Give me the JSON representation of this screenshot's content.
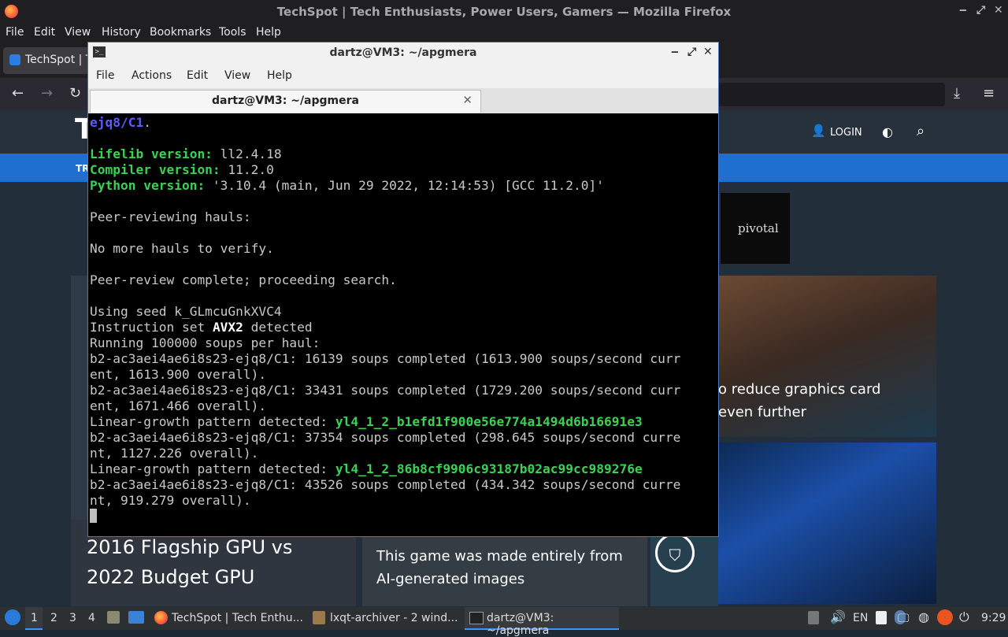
{
  "firefox": {
    "window_title": "TechSpot | Tech Enthusiasts, Power Users, Gamers — Mozilla Firefox",
    "menu": [
      "File",
      "Edit",
      "View",
      "History",
      "Bookmarks",
      "Tools",
      "Help"
    ],
    "tab_label": "TechSpot | T"
  },
  "site": {
    "logo": "T",
    "login": "LOGIN",
    "nav_item": "TR",
    "ad_text": "pivotal",
    "card_gpu_text": "o reduce graphics card\neven further",
    "card_flag_text": "2016 Flagship GPU vs\n2022 Budget GPU",
    "card_mid_text": "This game was made entirely from\nAI-generated images"
  },
  "terminal": {
    "window_title": "dartz@VM3: ~/apgmera",
    "menu": [
      "File",
      "Actions",
      "Edit",
      "View",
      "Help"
    ],
    "tab_label": "dartz@VM3: ~/apgmera",
    "lines": [
      {
        "parts": [
          {
            "t": "ejq8/C1",
            "c": "bl b"
          },
          {
            "t": "."
          }
        ]
      },
      {
        "parts": [
          {
            "t": ""
          }
        ]
      },
      {
        "parts": [
          {
            "t": "Lifelib version:",
            "c": "g b"
          },
          {
            "t": " ll2.4.18"
          }
        ]
      },
      {
        "parts": [
          {
            "t": "Compiler version:",
            "c": "g b"
          },
          {
            "t": " 11.2.0"
          }
        ]
      },
      {
        "parts": [
          {
            "t": "Python version:",
            "c": "g b"
          },
          {
            "t": " '3.10.4 (main, Jun 29 2022, 12:14:53) [GCC 11.2.0]'"
          }
        ]
      },
      {
        "parts": [
          {
            "t": ""
          }
        ]
      },
      {
        "parts": [
          {
            "t": "Peer-reviewing hauls:"
          }
        ]
      },
      {
        "parts": [
          {
            "t": ""
          }
        ]
      },
      {
        "parts": [
          {
            "t": "No more hauls to verify."
          }
        ]
      },
      {
        "parts": [
          {
            "t": ""
          }
        ]
      },
      {
        "parts": [
          {
            "t": "Peer-review complete; proceeding search."
          }
        ]
      },
      {
        "parts": [
          {
            "t": ""
          }
        ]
      },
      {
        "parts": [
          {
            "t": "Using seed k_GLmcuGnkXVC4"
          }
        ]
      },
      {
        "parts": [
          {
            "t": "Instruction set "
          },
          {
            "t": "AVX2",
            "c": "w b"
          },
          {
            "t": " detected"
          }
        ]
      },
      {
        "parts": [
          {
            "t": "Running 100000 soups per haul:"
          }
        ]
      },
      {
        "parts": [
          {
            "t": "b2-ac3aei4ae6i8s23-ejq8/C1: 16139 soups completed (1613.900 soups/second curr"
          }
        ]
      },
      {
        "parts": [
          {
            "t": "ent, 1613.900 overall)."
          }
        ]
      },
      {
        "parts": [
          {
            "t": "b2-ac3aei4ae6i8s23-ejq8/C1: 33431 soups completed (1729.200 soups/second curr"
          }
        ]
      },
      {
        "parts": [
          {
            "t": "ent, 1671.466 overall)."
          }
        ]
      },
      {
        "parts": [
          {
            "t": "Linear-growth pattern detected: "
          },
          {
            "t": "yl4_1_2_b1efd1f900e56e774a1494d6b16691e3",
            "c": "g b"
          }
        ]
      },
      {
        "parts": [
          {
            "t": "b2-ac3aei4ae6i8s23-ejq8/C1: 37354 soups completed (298.645 soups/second curre"
          }
        ]
      },
      {
        "parts": [
          {
            "t": "nt, 1127.226 overall)."
          }
        ]
      },
      {
        "parts": [
          {
            "t": "Linear-growth pattern detected: "
          },
          {
            "t": "yl4_1_2_86b8cf9906c93187b02ac99cc989276e",
            "c": "g b"
          }
        ]
      },
      {
        "parts": [
          {
            "t": "b2-ac3aei4ae6i8s23-ejq8/C1: 43526 soups completed (434.342 soups/second curre"
          }
        ]
      },
      {
        "parts": [
          {
            "t": "nt, 919.279 overall)."
          }
        ]
      }
    ]
  },
  "taskbar": {
    "desktops": [
      "1",
      "2",
      "3",
      "4"
    ],
    "tasks": [
      "TechSpot | Tech Enthu...",
      "lxqt-archiver - 2 wind...",
      "dartz@VM3: ~/apgmera"
    ],
    "keyboard_layout": "EN",
    "clock": "9:29"
  }
}
